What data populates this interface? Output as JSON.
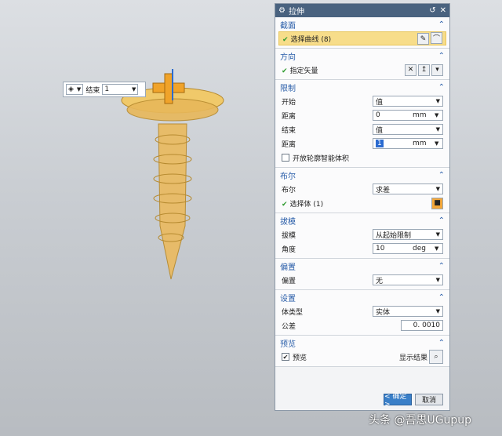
{
  "dialog": {
    "title": "拉伸",
    "sections": {
      "section": {
        "header": "截面",
        "select_curve_label": "选择曲线 (8)"
      },
      "direction": {
        "header": "方向",
        "specify_vector_label": "指定矢量"
      },
      "limits": {
        "header": "限制",
        "start_label": "开始",
        "start_value": "值",
        "start_distance_label": "距离",
        "start_distance": "0",
        "start_unit": "mm",
        "end_label": "结束",
        "end_value": "值",
        "end_distance_label": "距离",
        "end_distance": "1",
        "end_unit": "mm",
        "open_profile_label": "开放轮廓智能体积"
      },
      "boolean": {
        "header": "布尔",
        "boolean_label": "布尔",
        "boolean_value": "求差",
        "select_body_label": "选择体 (1)"
      },
      "draft": {
        "header": "拔模",
        "draft_label": "拔模",
        "draft_value": "从起始限制",
        "angle_label": "角度",
        "angle_value": "10",
        "angle_unit": "deg"
      },
      "offset": {
        "header": "偏置",
        "offset_label": "偏置",
        "offset_value": "无"
      },
      "settings": {
        "header": "设置",
        "body_type_label": "体类型",
        "body_type_value": "实体",
        "tolerance_label": "公差",
        "tolerance_value": "0. 0010"
      },
      "preview": {
        "header": "预览",
        "preview_label": "预览",
        "show_result_label": "显示结果"
      }
    },
    "ok_label": "< 确定 >",
    "cancel_label": "取消"
  },
  "mini_toolbar": {
    "end_label": "结束",
    "end_value": "1"
  },
  "watermark": "头条 @吾思UGupup"
}
